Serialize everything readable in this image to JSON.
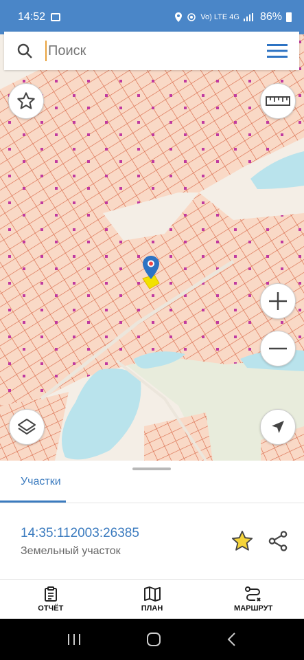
{
  "status_bar": {
    "time": "14:52",
    "network": "Vo) LTE 4G",
    "battery": "86%"
  },
  "search": {
    "placeholder": "Поиск"
  },
  "map": {
    "water_color": "#b9e3ec",
    "parcel_fill": "#f9d9c6",
    "parcel_stroke": "#d96a4a",
    "marker_color": "#2d73c3"
  },
  "panel": {
    "tab_label": "Участки",
    "parcel_id": "14:35:112003:26385",
    "parcel_type": "Земельный участок"
  },
  "bottom_nav": [
    {
      "label": "ОТЧЁТ",
      "icon": "clipboard-icon"
    },
    {
      "label": "ПЛАН",
      "icon": "map-icon"
    },
    {
      "label": "МАРШРУТ",
      "icon": "route-icon"
    }
  ]
}
